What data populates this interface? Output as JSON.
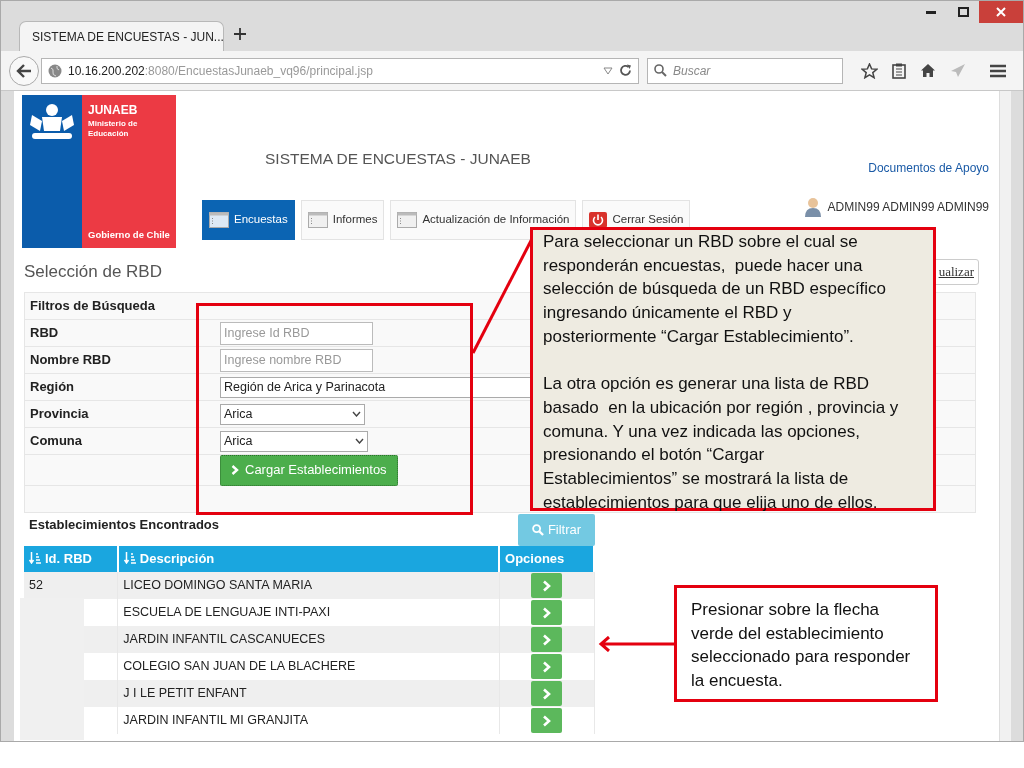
{
  "browser": {
    "tab_title": "SISTEMA DE ENCUESTAS - JUN...",
    "address": {
      "host": "10.16.200.202",
      "path": ":8080/EncuestasJunaeb_vq96/principal.jsp"
    },
    "search": {
      "placeholder": "Buscar"
    }
  },
  "header": {
    "brand": "JUNAEB",
    "ministry": "Ministerio de Educación",
    "government": "Gobierno de Chile",
    "title": "SISTEMA DE ENCUESTAS - JUNAEB",
    "help_link": "Documentos de Apoyo",
    "user": "ADMIN99 ADMIN99 ADMIN99"
  },
  "nav_tabs": [
    {
      "label": "Encuestas",
      "kind": "menu",
      "selected": true
    },
    {
      "label": "Informes",
      "kind": "menu",
      "selected": false
    },
    {
      "label": "Actualización de Información",
      "kind": "menu",
      "selected": false
    },
    {
      "label": "Cerrar Sesión",
      "kind": "logout",
      "selected": false
    }
  ],
  "page_title": "Selección de RBD",
  "refresh_button": "ualizar",
  "filters": {
    "heading": "Filtros de Búsqueda",
    "fields": [
      {
        "label": "RBD",
        "kind": "input",
        "placeholder": "Ingrese Id RBD"
      },
      {
        "label": "Nombre RBD",
        "kind": "input",
        "placeholder": "Ingrese nombre RBD"
      },
      {
        "label": "Región",
        "kind": "select",
        "value": "Región de Arica y Parinacota"
      },
      {
        "label": "Provincia",
        "kind": "select",
        "value": "Arica"
      },
      {
        "label": "Comuna",
        "kind": "select",
        "value": "Arica"
      }
    ],
    "submit": "Cargar Establecimientos"
  },
  "results": {
    "heading": "Establecimientos Encontrados",
    "filter_button": "Filtrar",
    "columns": [
      "Id. RBD",
      "Descripción",
      "Opciones"
    ],
    "rows": [
      {
        "id": "52",
        "name": "LICEO DOMINGO SANTA MARIA"
      },
      {
        "name": "ESCUELA DE LENGUAJE INTI-PAXI"
      },
      {
        "name": "JARDIN INFANTIL CASCANUECES"
      },
      {
        "name": "COLEGIO SAN JUAN DE LA BLACHERE"
      },
      {
        "name": "J I LE PETIT ENFANT"
      },
      {
        "name": "JARDIN INFANTIL MI GRANJITA"
      }
    ]
  },
  "callouts": [
    {
      "paragraphs": [
        "Para seleccionar un RBD sobre el cual se responderán encuestas,  puede hacer una selección de búsqueda de un RBD específico ingresando únicamente el RBD y posteriormente “Cargar Establecimiento”.",
        "La otra opción es generar una lista de RBD basado  en la ubicación por región , provincia y comuna. Y una vez indicada las opciones, presionando el botón “Cargar Establecimientos” se mostrará la lista de establecimientos para que elija uno de ellos."
      ]
    },
    {
      "paragraphs": [
        "Presionar sobre la flecha verde del establecimiento seleccionado para responder la encuesta."
      ]
    }
  ]
}
